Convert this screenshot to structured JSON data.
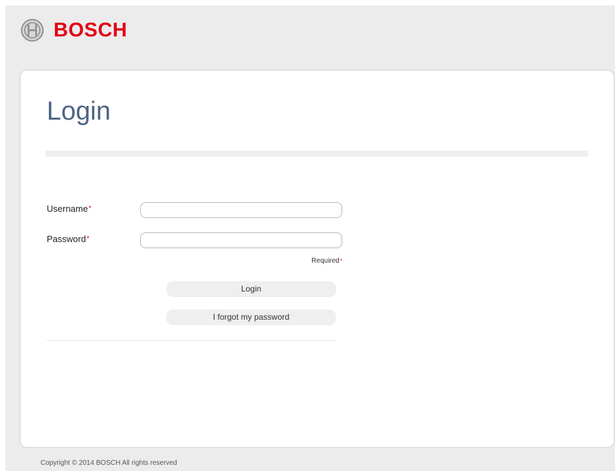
{
  "header": {
    "logo_icon": "bosch-armature-logo-icon",
    "brand_name": "BOSCH"
  },
  "login_form": {
    "title": "Login",
    "username_label": "Username",
    "password_label": "Password",
    "required_marker": "*",
    "username_value": "",
    "password_value": "",
    "required_note": "Required",
    "login_button_label": "Login",
    "forgot_password_label": "I forgot my password"
  },
  "footer": {
    "copyright": "Copyright © 2014 BOSCH All rights reserved"
  },
  "colors": {
    "brand_red": "#e20015",
    "title_blue": "#4e6383",
    "page_background": "#ececec",
    "card_background": "#ffffff",
    "button_background": "#efefef"
  }
}
